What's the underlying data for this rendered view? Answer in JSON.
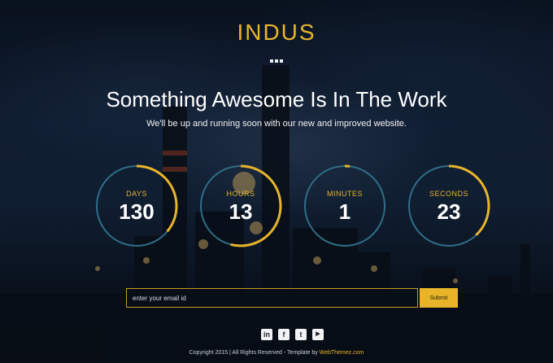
{
  "brand": {
    "logo_text": "INDUS"
  },
  "hero": {
    "headline": "Something Awesome Is In The Work",
    "subheadline": "We'll be up and running soon with our new and improved website."
  },
  "countdown": [
    {
      "label": "DAYS",
      "value": "130",
      "progress": 0.36
    },
    {
      "label": "HOURS",
      "value": "13",
      "progress": 0.54
    },
    {
      "label": "MINUTES",
      "value": "1",
      "progress": 0.02
    },
    {
      "label": "SECONDS",
      "value": "23",
      "progress": 0.38
    }
  ],
  "subscribe": {
    "placeholder": "enter your email id",
    "submit_label": "Submit"
  },
  "social": [
    {
      "icon": "linkedin-icon",
      "glyph": "in"
    },
    {
      "icon": "facebook-icon",
      "glyph": "f"
    },
    {
      "icon": "twitter-icon",
      "glyph": "t"
    },
    {
      "icon": "youtube-icon",
      "glyph": "▶"
    }
  ],
  "footer": {
    "copyright": "Copyright 2015 | All Rights Reserved - Template by ",
    "link_text": "WebThemez.com"
  },
  "colors": {
    "accent": "#e8b52a",
    "ring_track": "#2f6e86",
    "background": "#0d1626"
  }
}
